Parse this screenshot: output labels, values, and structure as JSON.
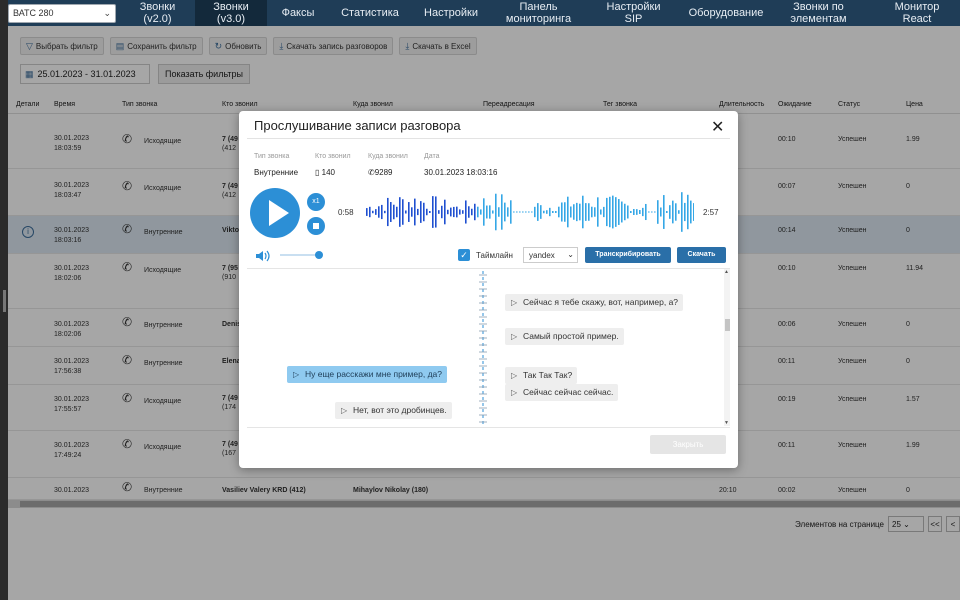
{
  "station": "ВАТС 280",
  "nav": [
    {
      "label1": "Звонки",
      "label2": "(v2.0)"
    },
    {
      "label1": "Звонки",
      "label2": "(v3.0)"
    },
    {
      "label1": "Факсы",
      "label2": ""
    },
    {
      "label1": "Статистика",
      "label2": ""
    },
    {
      "label1": "Настройки",
      "label2": ""
    },
    {
      "label1": "Панель",
      "label2": "мониторинга"
    },
    {
      "label1": "Настройки",
      "label2": "SIP"
    },
    {
      "label1": "Оборудование",
      "label2": ""
    },
    {
      "label1": "Звонки по",
      "label2": "элементам"
    },
    {
      "label1": "Монитор",
      "label2": "React"
    }
  ],
  "toolbar": {
    "choose_filter": "Выбрать фильтр",
    "save_filter": "Сохранить фильтр",
    "refresh": "Обновить",
    "download_records": "Скачать запись разговоров",
    "export_excel": "Скачать в Excel"
  },
  "dates": "25.01.2023 - 31.01.2023",
  "show_filters": "Показать фильтры",
  "columns": {
    "details": "Детали",
    "time": "Время",
    "type": "Тип звонка",
    "who": "Кто звонил",
    "whom": "Куда звонил",
    "redirect": "Переадресация",
    "tag": "Тег звонка",
    "duration": "Длительность",
    "wait": "Ожидание",
    "status": "Статус",
    "price": "Цена"
  },
  "rows": [
    {
      "date": "30.01.2023",
      "time": "18:03:59",
      "type": "Исходящие",
      "who": "7 (49",
      "who2": "(412",
      "wait": "00:10",
      "status": "Успешен",
      "price": "1.99"
    },
    {
      "date": "30.01.2023",
      "time": "18:03:47",
      "type": "Исходящие",
      "who": "7 (49",
      "who2": "(412",
      "wait": "00:07",
      "status": "Успешен",
      "price": "0"
    },
    {
      "date": "30.01.2023",
      "time": "18:03:16",
      "type": "Внутренние",
      "who": "Vikto",
      "who2": "",
      "wait": "00:14",
      "status": "Успешен",
      "price": "0"
    },
    {
      "date": "30.01.2023",
      "time": "18:02:06",
      "type": "Исходящие",
      "who": "7 (95",
      "who2": "(910",
      "wait": "00:10",
      "status": "Успешен",
      "price": "11.94"
    },
    {
      "date": "30.01.2023",
      "time": "18:02:06",
      "type": "Внутренние",
      "who": "Denis",
      "who2": "",
      "wait": "00:06",
      "status": "Успешен",
      "price": "0"
    },
    {
      "date": "30.01.2023",
      "time": "17:56:38",
      "type": "Внутренние",
      "who": "Elena",
      "who2": "",
      "wait": "00:11",
      "status": "Успешен",
      "price": "0"
    },
    {
      "date": "30.01.2023",
      "time": "17:55:57",
      "type": "Исходящие",
      "who": "7 (49",
      "who2": "(174",
      "wait": "00:19",
      "status": "Успешен",
      "price": "1.57"
    },
    {
      "date": "30.01.2023",
      "time": "17:49:24",
      "type": "Исходящие",
      "who": "7 (49",
      "who2": "(167",
      "wait": "00:11",
      "status": "Успешен",
      "price": "1.99"
    },
    {
      "date": "30.01.2023",
      "time": "",
      "type": "Внутренние",
      "who": "Vasiliev Valery KRD (412)",
      "who2": "",
      "whom": "Mihaylov Nikolay (180)",
      "duration": "20:10",
      "wait": "00:02",
      "status": "Успешен",
      "price": "0"
    }
  ],
  "pager": {
    "label": "Элементов на странице",
    "size": "25",
    "first": "<<",
    "prev": "<"
  },
  "modal": {
    "title": "Прослушивание записи разговора",
    "close": "✕",
    "lbl_type": "Тип звонка",
    "lbl_from": "Кто звонил",
    "lbl_to": "Куда звонил",
    "lbl_date": "Дата",
    "type": "Внутренние",
    "from": "140",
    "to": "9289",
    "date": "30.01.2023 18:03:16",
    "speed": "x1",
    "t_start": "0:58",
    "t_end": "2:57",
    "volume": 0.85,
    "timeline_label": "Таймлайн",
    "engine": "yandex",
    "transcribe": "Транскрибировать",
    "download": "Скачать",
    "close_button": "Закрыть",
    "progress_fraction": 0.33,
    "accent": "#2c8fd6"
  },
  "transcript": [
    {
      "side": "right",
      "text": "Сейчас я тебе скажу, вот, например, а?"
    },
    {
      "side": "right",
      "text": "Самый простой пример."
    },
    {
      "side": "left",
      "text": "Ну еще расскажи мне пример, да?"
    },
    {
      "side": "right",
      "text": "Так Так Так?"
    },
    {
      "side": "right",
      "text": "Сейчас сейчас сейчас."
    },
    {
      "side": "left",
      "text": "Нет, вот это дробинцев."
    }
  ]
}
